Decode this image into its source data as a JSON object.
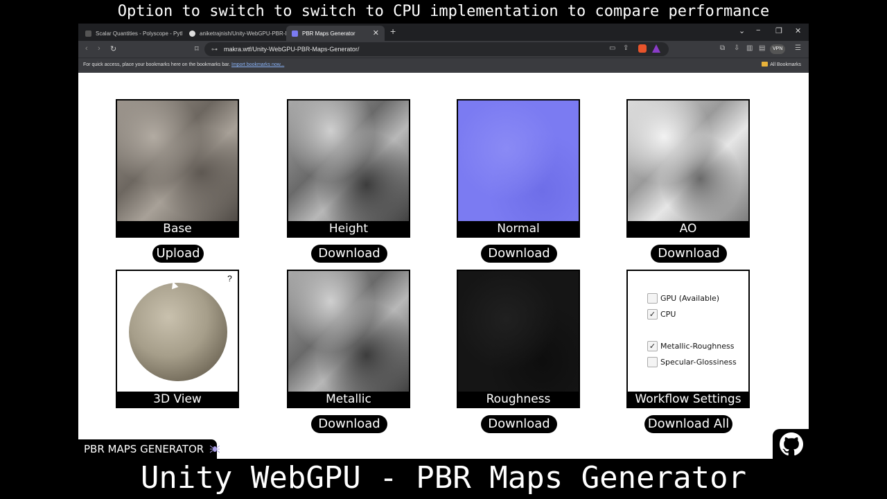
{
  "caption": {
    "top": "Option to switch to switch to CPU implementation to compare performance",
    "bottom": "Unity WebGPU - PBR Maps Generator"
  },
  "browser": {
    "tabs": [
      {
        "label": "Scalar Quantities - Polyscope - Pyth"
      },
      {
        "label": "aniketrajnish/Unity-WebGPU-PBR-M"
      },
      {
        "label": "PBR Maps Generator",
        "active": true
      }
    ],
    "new_tab": "+",
    "url": "makra.wtf/Unity-WebGPU-PBR-Maps-Generator/",
    "vpn_label": "VPN",
    "bookmarks_text": "For quick access, place your bookmarks here on the bookmarks bar.",
    "bookmarks_link": "Import bookmarks now...",
    "all_bookmarks": "All Bookmarks"
  },
  "maps": [
    {
      "label": "Base",
      "button": "Upload"
    },
    {
      "label": "Height",
      "button": "Download"
    },
    {
      "label": "Normal",
      "button": "Download"
    },
    {
      "label": "AO",
      "button": "Download"
    },
    {
      "label": "3D View",
      "help": "?"
    },
    {
      "label": "Metallic",
      "button": "Download"
    },
    {
      "label": "Roughness",
      "button": "Download"
    },
    {
      "label": "Workflow Settings",
      "button": "Download All"
    }
  ],
  "settings": {
    "gpu": {
      "label": "GPU (Available)",
      "checked": false
    },
    "cpu": {
      "label": "CPU",
      "checked": true,
      "mark": "✓"
    },
    "metallic_roughness": {
      "label": "Metallic-Roughness",
      "checked": true,
      "mark": "✓"
    },
    "specular_glossiness": {
      "label": "Specular-Glossiness",
      "checked": false
    }
  },
  "brand": {
    "title": "PBR MAPS GENERATOR"
  },
  "colors": {
    "normal_map": "#7b7bf2",
    "page_bg": "#ffffff",
    "chrome_dark": "#1f2023"
  }
}
